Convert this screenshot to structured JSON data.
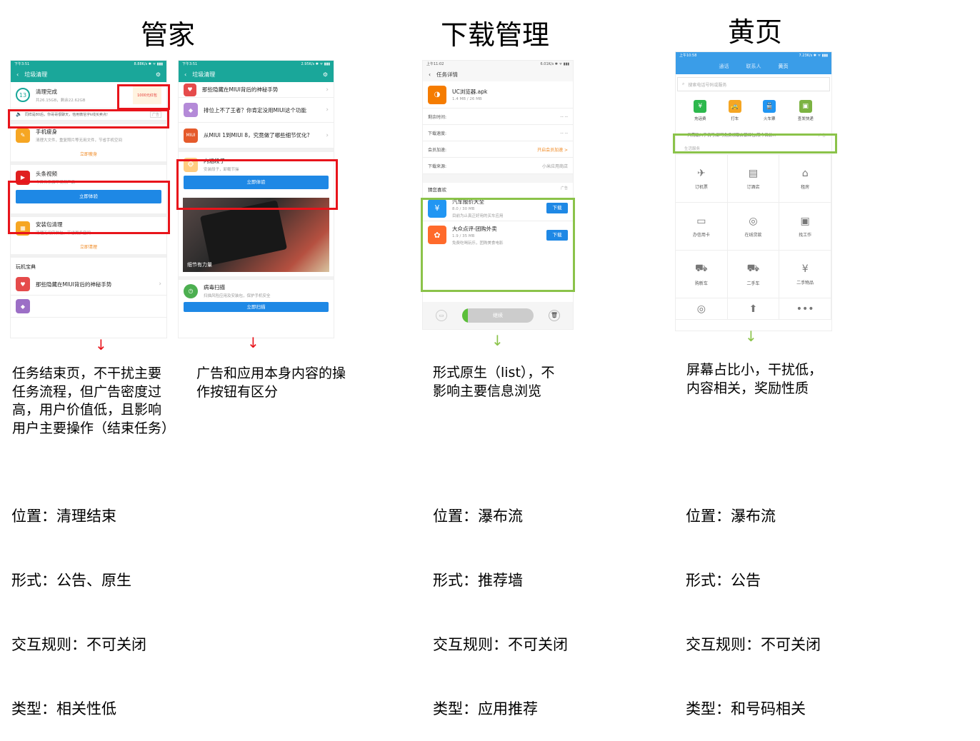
{
  "titles": {
    "guanjia": "管家",
    "download": "下载管理",
    "yellow": "黄页"
  },
  "p1": {
    "status": {
      "time": "下午3:51",
      "right": "8.88K/s ✱ ᯤ ▮▮▮"
    },
    "header": "垃圾清理",
    "clean_num": "13",
    "clean_title": "清理完成",
    "clean_sub": "共26.15GB，剩余22.62GB",
    "ad_badge": "1000元红包",
    "notice_text": "同样是80后，你哥哥很聊天，他用微信字k线买卖点!",
    "notice_tag": "广告",
    "slim_title": "手机瘦身",
    "slim_sub": "清理大文件，重复照片等无用文件，节省手机空间",
    "slim_link": "立即瘦身",
    "video_title": "头条视频",
    "video_sub": "今日头条旗下视频产品",
    "video_btn": "立即体验",
    "pkg_title": "安装包清理",
    "pkg_sub": "清理无用安装包，节省更多空间",
    "pkg_link": "立即清理",
    "section": "玩机宝典",
    "tip1": "那些隐藏在MIUI背后的神秘手势"
  },
  "p2": {
    "status": {
      "time": "下午3:51",
      "right": "2.95K/s ✱ ᯤ ▮▮▮"
    },
    "header": "垃圾清理",
    "item1": "那些隐藏在MIUI背后的神秘手势",
    "item2": "排位上不了王者？你肯定没用MIUI这个功能",
    "item3": "从MIUI 1到MIUI 8，究竟做了哪些细节优化?",
    "item3_icon": "MIUI",
    "joke_title": "内涵段子",
    "joke_sub": "安装段子，卸载节操",
    "joke_btn": "立即体验",
    "photo_caption": "细节有力量",
    "virus_title": "病毒扫描",
    "virus_sub": "扫描风险应用及安装包，保护手机安全",
    "virus_btn": "立即扫描"
  },
  "p3": {
    "status": {
      "time": "上午11:02",
      "right": "6.01K/s ✱ ᯤ ▮▮▮"
    },
    "header": "任务详情",
    "file_name": "UC浏览器.apk",
    "file_size": "1.4 MB / 26 MB",
    "rows": [
      {
        "label": "剩余时间:",
        "value": "-- --"
      },
      {
        "label": "下载速度:",
        "value": "-- --"
      },
      {
        "label": "会员加速:",
        "value": "开启会员加速 >"
      },
      {
        "label": "下载来源:",
        "value": "小米应用商店"
      }
    ],
    "rec_title": "猜您喜欢",
    "rec_tag": "广告",
    "apps": [
      {
        "name": "汽车报价大全",
        "meta": "8.0 / 30 MB",
        "desc": "目前为止真正好用的买车应用",
        "btn": "下载"
      },
      {
        "name": "大众点评-团购外卖",
        "meta": "1.9 / 35 MB",
        "desc": "免费吃喝玩乐，团购美食电影",
        "btn": "下载"
      }
    ],
    "continue_btn": "继续"
  },
  "p4": {
    "status": {
      "time": "上午10:58",
      "right": "7.23K/s ✱ ᯤ ▮▮▮"
    },
    "tabs": [
      "通话",
      "联系人",
      "黄页"
    ],
    "search_placeholder": "搜索电话号码或服务",
    "quick": [
      {
        "label": "充话费",
        "icon": "¥",
        "color": "#2db84d"
      },
      {
        "label": "打车",
        "icon": "🚕",
        "color": "#f5a623"
      },
      {
        "label": "火车票",
        "icon": "🚆",
        "color": "#2196f3"
      },
      {
        "label": "查发快递",
        "icon": "▣",
        "color": "#7cb342"
      }
    ],
    "notice_text": "只需输入手机号,即可免费领取白银红包,限今日前...",
    "notice_tag": "广告",
    "section": "生活服务",
    "services": [
      {
        "label": "订机票",
        "icon": "✈"
      },
      {
        "label": "订酒店",
        "icon": "▤"
      },
      {
        "label": "租房",
        "icon": "⌂"
      },
      {
        "label": "办信用卡",
        "icon": "▭"
      },
      {
        "label": "在线贷款",
        "icon": "◎"
      },
      {
        "label": "找工作",
        "icon": "▣"
      },
      {
        "label": "购新车",
        "icon": "⛟"
      },
      {
        "label": "二手车",
        "icon": "⛟"
      },
      {
        "label": "二手物品",
        "icon": "¥"
      }
    ],
    "more_icon": "•••"
  },
  "notes": {
    "n1": "任务结束页，不干扰主要\n任务流程，但广告密度过\n高，用户价值低，且影响\n用户主要操作（结束任务）",
    "n2": "广告和应用本身内容的操\n作按钮有区分",
    "n3": "形式原生（list），不\n影响主要信息浏览",
    "n4": "屏幕占比小，干扰低，\n内容相关，奖励性质"
  },
  "summaries": {
    "s1": [
      "位置：清理结束",
      "形式：公告、原生",
      "交互规则：不可关闭",
      "类型：相关性低"
    ],
    "s2": [
      "位置：瀑布流",
      "形式：推荐墙",
      "交互规则：不可关闭",
      "类型：应用推荐"
    ],
    "s3": [
      "位置：瀑布流",
      "形式：公告",
      "交互规则：不可关闭",
      "类型：和号码相关"
    ]
  },
  "colors": {
    "teal": "#1aa79a",
    "red_box": "#e8141b",
    "green_box": "#8bc34a",
    "blue": "#1e88e5",
    "orange": "#f08a24"
  }
}
